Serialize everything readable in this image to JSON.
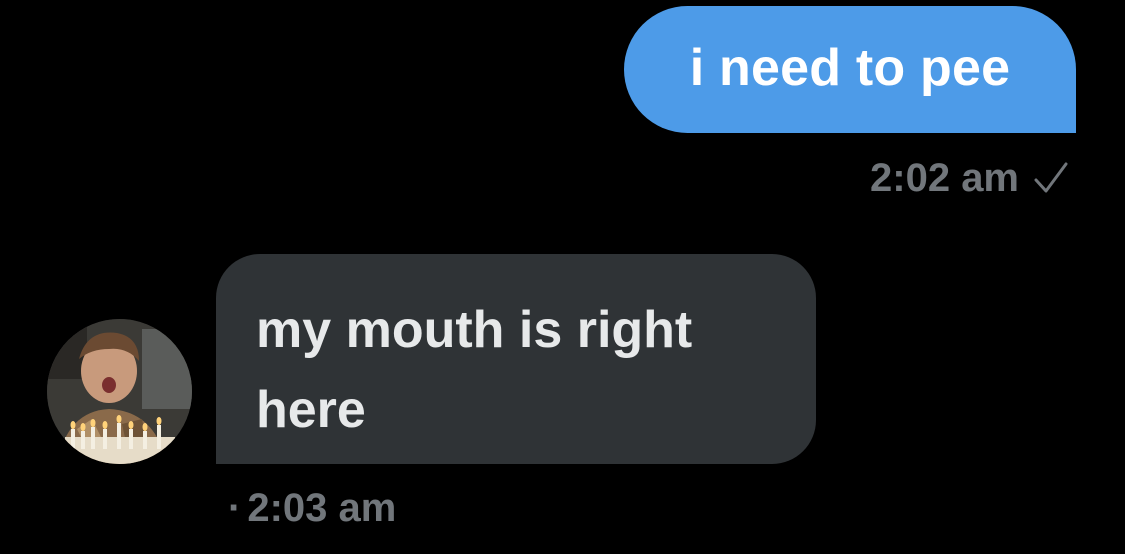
{
  "messages": [
    {
      "direction": "outgoing",
      "text": "i need to pee",
      "time": "2:02 am",
      "status_icon": "checkmark-icon"
    },
    {
      "direction": "incoming",
      "text": "my mouth is right here",
      "separator": "·",
      "time": "2:03 am",
      "avatar_icon": "avatar-photo"
    }
  ],
  "colors": {
    "background": "#000000",
    "outgoing_bubble": "#4d9be8",
    "incoming_bubble": "#2f3336",
    "timestamp": "#71767b"
  }
}
